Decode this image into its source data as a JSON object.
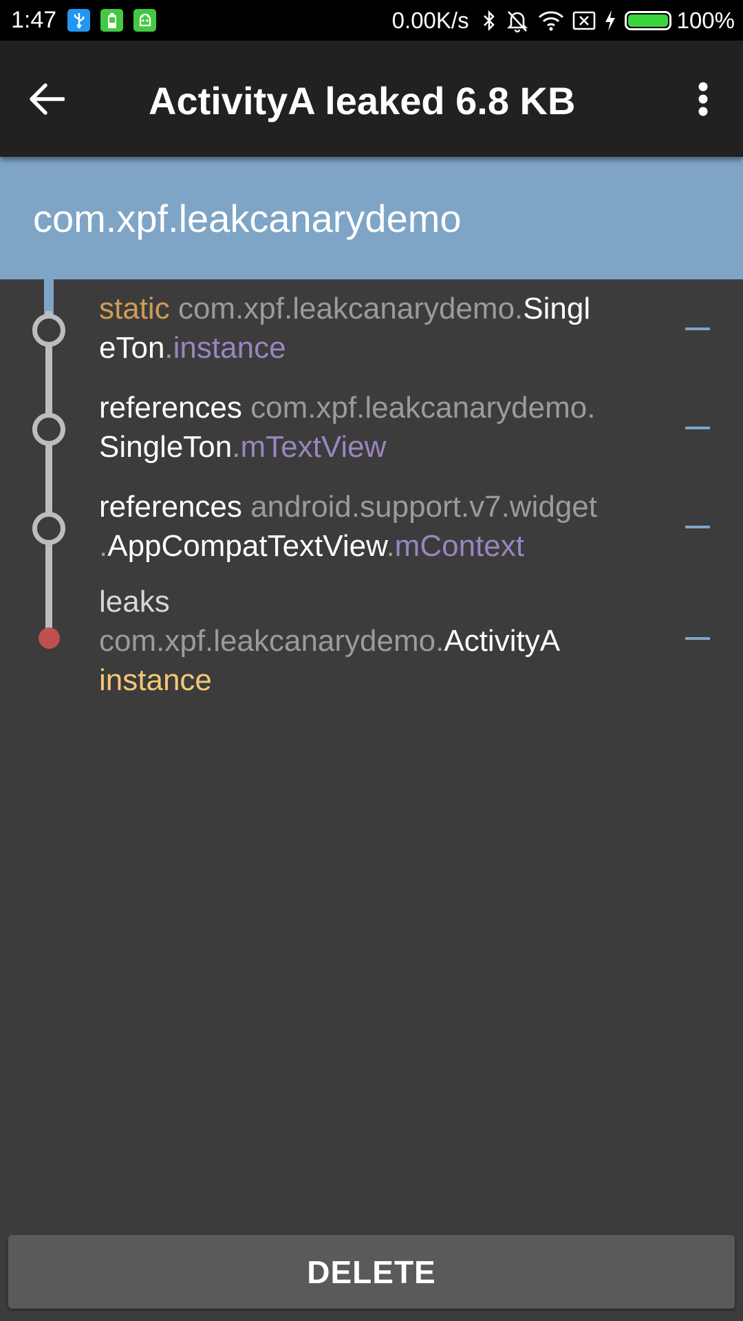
{
  "status_bar": {
    "time": "1:47",
    "net_speed": "0.00K/s",
    "battery_percent": "100%",
    "battery_level": 1.0,
    "notification_icons": [
      "usb-icon",
      "battery-saver-icon",
      "android-debug-icon"
    ],
    "system_icons": [
      "bluetooth-icon",
      "vibrate-off-icon",
      "wifi-icon",
      "sim-missing-icon",
      "charging-bolt-icon",
      "battery-icon"
    ]
  },
  "toolbar": {
    "title": "ActivityA leaked 6.8 KB",
    "back_icon": "arrow-left-icon",
    "overflow_icon": "more-vert-icon"
  },
  "header": {
    "package_name": "com.xpf.leakcanarydemo",
    "background_color": "#7fa5c6"
  },
  "trace": {
    "rows": [
      {
        "line1": {
          "keyword": "static",
          "package": "com.xpf.leakcanarydemo.",
          "class": "Singl"
        },
        "line2": {
          "class": "eTon",
          "dot": ".",
          "field": "instance"
        }
      },
      {
        "line1": {
          "keyword": "references",
          "package": "com.xpf.leakcanarydemo."
        },
        "line2": {
          "class": "SingleTon",
          "dot": ".",
          "field": "mTextView"
        }
      },
      {
        "line1": {
          "keyword": "references",
          "package": "android.support.v7.widget"
        },
        "line2": {
          "prefix": ".",
          "class": "AppCompatTextView",
          "dot": ".",
          "field": "mContext"
        }
      },
      {
        "line1": {
          "keyword": "leaks"
        },
        "line2": {
          "package": "com.xpf.leakcanarydemo.",
          "class": "ActivityA"
        },
        "line3": {
          "instance": "instance"
        }
      }
    ],
    "colors": {
      "static_keyword": "#d19b57",
      "package": "#9b9b9b",
      "field": "#9a85c0",
      "instance": "#f5c875",
      "leak_node": "#c0504d",
      "line": "#bdbdbd"
    }
  },
  "actions": {
    "delete_label": "DELETE"
  }
}
